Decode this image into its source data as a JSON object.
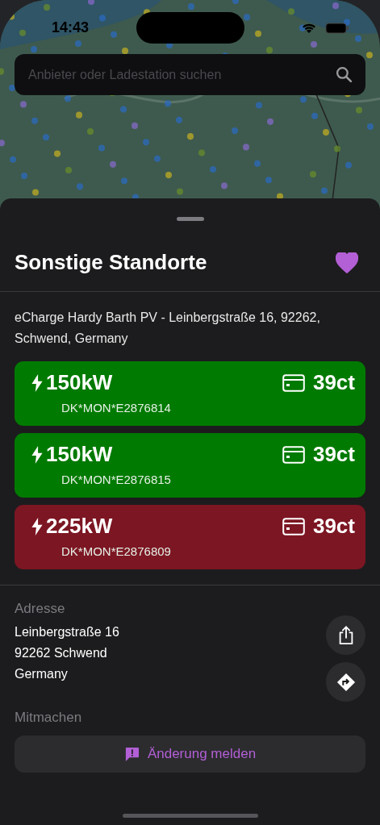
{
  "status_bar": {
    "time": "14:43"
  },
  "search": {
    "placeholder": "Anbieter oder Ladestation suchen"
  },
  "sheet": {
    "title": "Sonstige Standorte",
    "favorite": true,
    "location": "eCharge Hardy Barth PV - Leinbergstraße 16, 92262, Schwend, Germany",
    "connectors": [
      {
        "power": "150kW",
        "id": "DK*MON*E2876814",
        "price": "39ct",
        "color": "#007a00"
      },
      {
        "power": "150kW",
        "id": "DK*MON*E2876815",
        "price": "39ct",
        "color": "#007a00"
      },
      {
        "power": "225kW",
        "id": "DK*MON*E2876809",
        "price": "39ct",
        "color": "#7c1623"
      }
    ],
    "address_label": "Adresse",
    "address_lines": [
      "Leinbergstraße 16",
      "92262 Schwend",
      "Germany"
    ],
    "contribute_label": "Mitmachen",
    "report_button": "Änderung melden"
  }
}
